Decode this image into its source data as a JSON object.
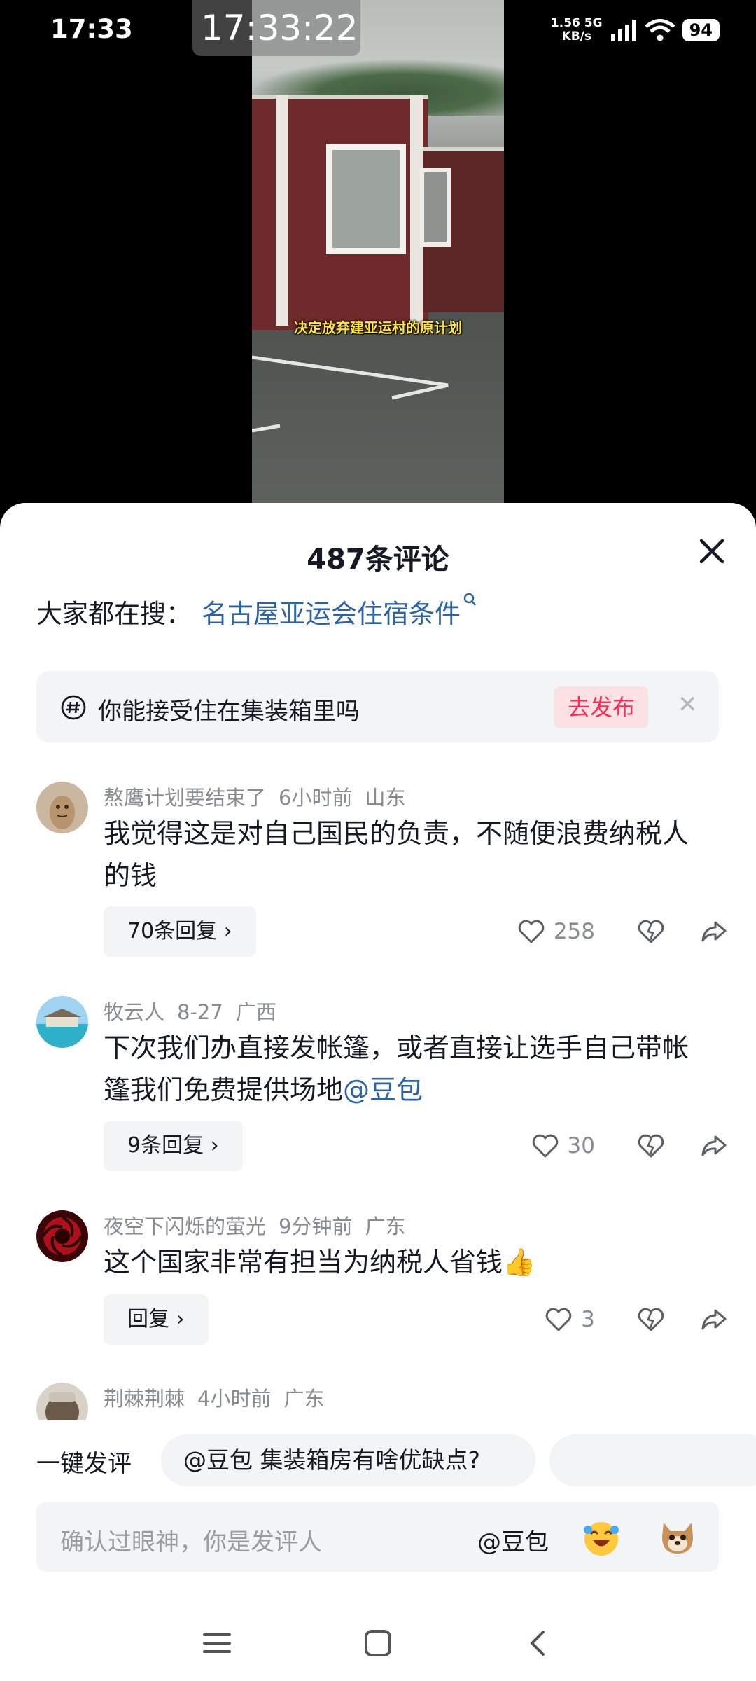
{
  "status_bar": {
    "time": "17:33",
    "overlay_time": "17:33:22",
    "net_speed_value": "1.56",
    "net_speed_unit": "KB/s",
    "network_type": "5G",
    "battery": "94"
  },
  "video": {
    "subtitle": "决定放弃建亚运村的原计划"
  },
  "comments_panel": {
    "title": "487条评论",
    "search_prefix": "大家都在搜：",
    "search_link": "名古屋亚运会住宿条件",
    "topic": {
      "text": "你能接受住在集装箱里吗",
      "button": "去发布"
    },
    "comments": [
      {
        "user": "熬鹰计划要结束了",
        "time": "6小时前",
        "location": "山东",
        "text": "我觉得这是对自己国民的负责，不随便浪费纳税人的钱",
        "mention": "",
        "replies_label": "70条回复 ›",
        "likes": "258",
        "avatar_color": "#b7946e"
      },
      {
        "user": "牧云人",
        "time": "8-27",
        "location": "广西",
        "text": "下次我们办直接发帐篷，或者直接让选手自己带帐篷我们免费提供场地",
        "mention": "@豆包",
        "replies_label": "9条回复 ›",
        "likes": "30",
        "avatar_color": "#5aa9d6"
      },
      {
        "user": "夜空下闪烁的萤光",
        "time": "9分钟前",
        "location": "广东",
        "text": "这个国家非常有担当为纳税人省钱👍",
        "mention": "",
        "replies_label": "回复 ›",
        "likes": "3",
        "avatar_color": "#b0101a"
      },
      {
        "user": "荆棘荆棘",
        "time": "4小时前",
        "location": "广东",
        "avatar_color": "#6b5a48"
      }
    ]
  },
  "quick_comment": {
    "label": "一键发评",
    "chip": "@豆包 集装箱房有啥优缺点?"
  },
  "input": {
    "placeholder": "确认过眼神，你是发评人",
    "mention": "@豆包"
  },
  "colors": {
    "accent_red": "#fe2c55",
    "link_blue": "#2b62a8",
    "subtitle_yellow": "#ffe43c"
  }
}
